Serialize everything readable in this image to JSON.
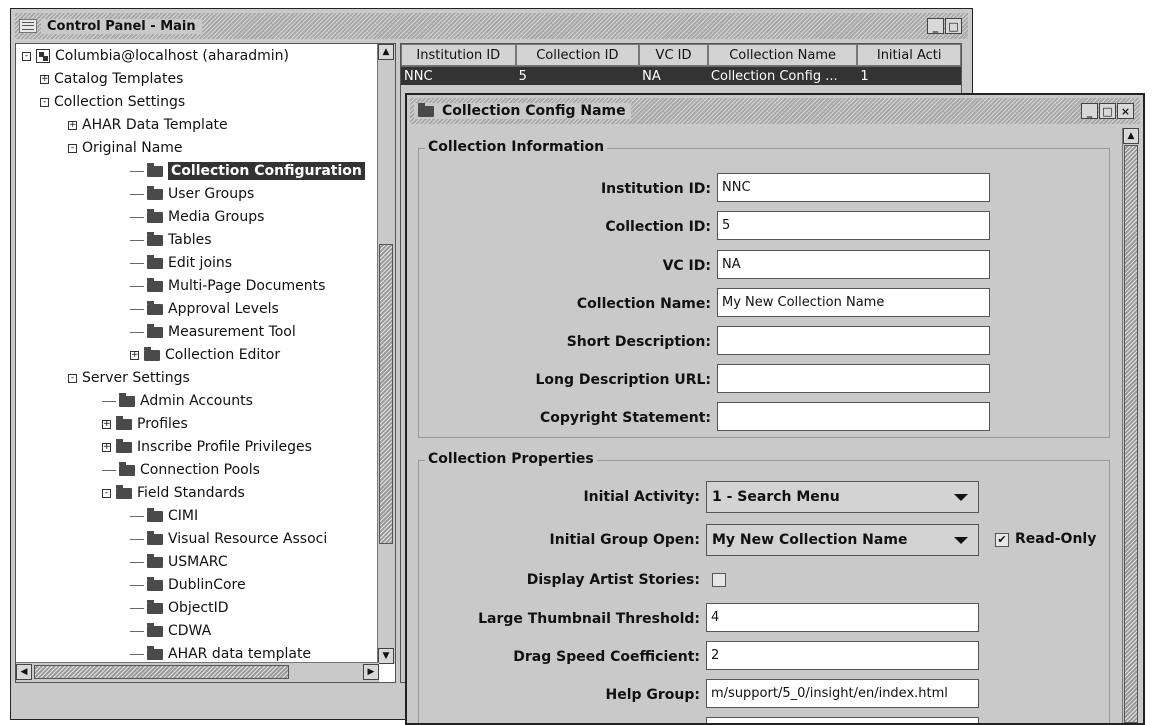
{
  "main_window": {
    "title": "Control Panel - Main",
    "btn_min": "_",
    "btn_max": "□"
  },
  "tree": {
    "root": "Columbia@localhost (aharadmin)",
    "catalog_templates": "Catalog Templates",
    "collection_settings": "Collection Settings",
    "ahar_data_template": "AHAR Data Template",
    "original_name": "Original Name",
    "collection_configuration": "Collection Configuration",
    "user_groups": "User Groups",
    "media_groups": "Media Groups",
    "tables": "Tables",
    "edit_joins": "Edit joins",
    "multi_page_documents": "Multi-Page Documents",
    "approval_levels": "Approval Levels",
    "measurement_tool": "Measurement Tool",
    "collection_editor": "Collection Editor",
    "server_settings": "Server Settings",
    "admin_accounts": "Admin Accounts",
    "profiles": "Profiles",
    "inscribe_profile_privileges": "Inscribe Profile Privileges",
    "connection_pools": "Connection Pools",
    "field_standards": "Field Standards",
    "cimi": "CIMI",
    "visual_resource": "Visual Resource Associ",
    "usmarc": "USMARC",
    "dublincore": "DublinCore",
    "objectid": "ObjectID",
    "cdwa": "CDWA",
    "ahar_data_template_lower": "AHAR data template"
  },
  "table": {
    "headers": [
      "Institution ID",
      "Collection ID",
      "VC ID",
      "Collection Name",
      "Initial Acti"
    ],
    "row": [
      "NNC",
      "5",
      "NA",
      "Collection Config ...",
      "1"
    ]
  },
  "config_window": {
    "title": "Collection Config Name",
    "btn_min": "_",
    "btn_max": "□",
    "btn_close": "×",
    "info_group": "Collection Information",
    "institution_id_label": "Institution ID:",
    "institution_id_value": "NNC",
    "collection_id_label": "Collection ID:",
    "collection_id_value": "5",
    "vc_id_label": "VC ID:",
    "vc_id_value": "NA",
    "collection_name_label": "Collection Name:",
    "collection_name_value": "My New Collection Name",
    "short_description_label": "Short Description:",
    "short_description_value": "",
    "long_description_url_label": "Long Description URL:",
    "long_description_url_value": "",
    "copyright_label": "Copyright Statement:",
    "copyright_value": "",
    "props_group": "Collection Properties",
    "initial_activity_label": "Initial Activity:",
    "initial_activity_value": "1 - Search Menu",
    "initial_group_open_label": "Initial Group Open:",
    "initial_group_open_value": "My New Collection Name",
    "read_only_label": "Read-Only",
    "read_only_checked": true,
    "display_artist_stories_label": "Display Artist Stories:",
    "display_artist_stories_checked": false,
    "large_thumbnail_label": "Large Thumbnail Threshold:",
    "large_thumbnail_value": "4",
    "drag_speed_label": "Drag Speed Coefficient:",
    "drag_speed_value": "2",
    "help_group_label": "Help Group:",
    "help_group_value": "m/support/5_0/insight/en/index.html"
  },
  "icons": {
    "expand": "+",
    "collapse": "-",
    "check": "✔",
    "arrow_up": "▲",
    "arrow_down": "▼",
    "arrow_left": "◀",
    "arrow_right": "▶"
  }
}
